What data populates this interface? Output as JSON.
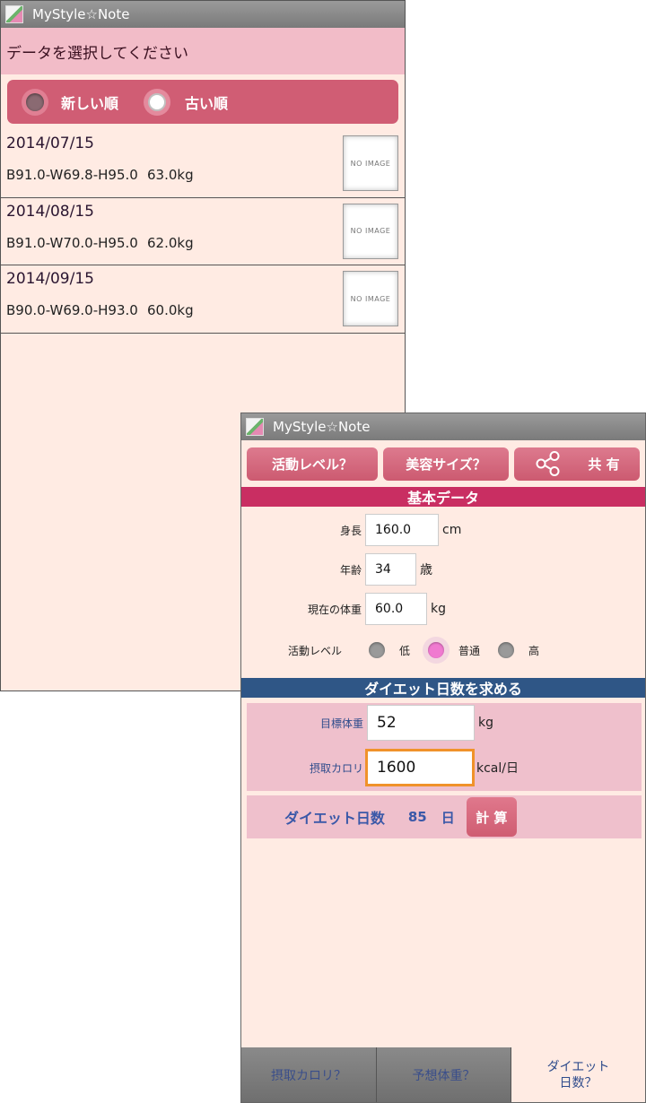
{
  "screen1": {
    "app_title": "MyStyle☆Note",
    "header": "データを選択してください",
    "sort_options": [
      {
        "label": "新しい順",
        "selected": false
      },
      {
        "label": "古い順",
        "selected": true
      }
    ],
    "records": [
      {
        "date": "2014/07/15",
        "measurements": "B91.0-W69.8-H95.0",
        "weight": "63.0kg",
        "image_label": "NO IMAGE"
      },
      {
        "date": "2014/08/15",
        "measurements": "B91.0-W70.0-H95.0",
        "weight": "62.0kg",
        "image_label": "NO IMAGE"
      },
      {
        "date": "2014/09/15",
        "measurements": "B90.0-W69.0-H93.0",
        "weight": "60.0kg",
        "image_label": "NO IMAGE"
      }
    ]
  },
  "screen2": {
    "app_title": "MyStyle☆Note",
    "toolbar": {
      "activity_label": "活動レベル？",
      "beauty_label": "美容サイズ？",
      "share_label": "共 有"
    },
    "basic_section": {
      "title": "基本データ",
      "height_label": "身長",
      "height_value": "160.0",
      "height_unit": "cm",
      "age_label": "年齢",
      "age_value": "34",
      "age_unit": "歳",
      "weight_label": "現在の体重",
      "weight_value": "60.0",
      "weight_unit": "kg",
      "activity_label": "活動レベル",
      "activity_options": [
        {
          "label": "低",
          "selected": false
        },
        {
          "label": "普通",
          "selected": true
        },
        {
          "label": "高",
          "selected": false
        }
      ]
    },
    "diet_section": {
      "title": "ダイエット日数を求める",
      "target_label": "目標体重",
      "target_value": "52",
      "target_unit": "kg",
      "calorie_label": "摂取カロリ",
      "calorie_value": "1600",
      "calorie_unit": "kcal/日",
      "result_label": "ダイエット日数",
      "result_value": "85",
      "result_unit": "日",
      "calc_label": "計 算"
    },
    "bottom_tabs": {
      "tab1": "摂取カロリ？",
      "tab2": "予想体重？",
      "tab3_line1": "ダイエット",
      "tab3_line2": "日数？"
    },
    "colors": {
      "accent": "#c92e62",
      "section_blue": "#2f5686",
      "background": "#ffebe3",
      "focus_border": "#f0922a"
    }
  }
}
